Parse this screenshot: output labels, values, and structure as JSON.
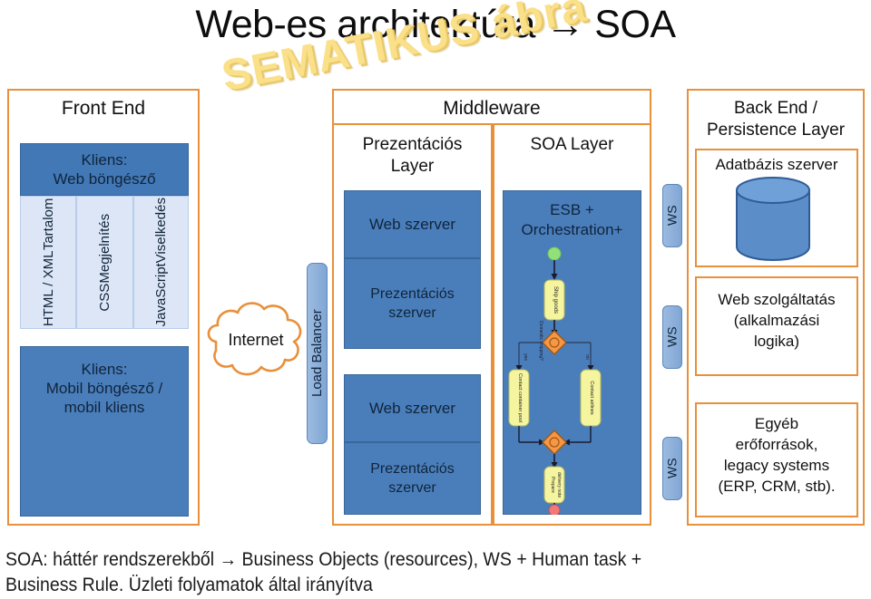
{
  "slide": {
    "title": "Web-es architektúra → SOA",
    "wordart": "SEMATIKUS ábra",
    "footer_line1": "SOA: háttér rendszerekből → Business Objects (resources), WS + Human task +",
    "footer_line2": "Business Rule. Üzleti folyamatok által irányítva"
  },
  "colors": {
    "zone_border": "#E8903A",
    "box_fill": "#4A7EBB",
    "box_fill_dark": "#4178B5",
    "light_fill": "#DCE6F6",
    "wordart": "#FBE08A",
    "flow_task": "#F2F29A",
    "flow_start": "#92E07A",
    "flow_end": "#F07878",
    "flow_gateway": "#F79646"
  },
  "front_end": {
    "title": "Front End",
    "client_web": "Kliens:\nWeb böngésző",
    "columns": [
      {
        "line1": "Tartalom",
        "line2": "HTML / XML"
      },
      {
        "line1": "Megjelnítés",
        "line2": "CSS"
      },
      {
        "line1": "Viselkedés",
        "line2": "JavaScript"
      }
    ],
    "client_mobile": "Kliens:\nMobil böngésző /\nmobil kliens"
  },
  "network": {
    "internet": "Internet",
    "load_balancer": "Load Balancer"
  },
  "middleware": {
    "title": "Middleware",
    "presentation": {
      "title": "Prezentációs\nLayer",
      "boxes": [
        "Web szerver",
        "Prezentációs\nszerver",
        "Web szerver",
        "Prezentációs\nszerver"
      ]
    },
    "soa": {
      "title": "SOA Layer",
      "box_title": "ESB +\nOrchestration+"
    }
  },
  "flowchart": {
    "start": "start",
    "end": "end",
    "nodes": [
      {
        "id": "ship",
        "label": "Ship goods",
        "type": "task"
      },
      {
        "id": "gw1",
        "label": "",
        "type": "gateway"
      },
      {
        "id": "pool",
        "label": "Contact container pool",
        "type": "task"
      },
      {
        "id": "air",
        "label": "Contact airlines",
        "type": "task"
      },
      {
        "id": "gw2",
        "label": "",
        "type": "gateway"
      },
      {
        "id": "note",
        "label": "Prepare delivery note",
        "type": "task"
      }
    ],
    "edge_labels": {
      "decision": "Domestic shipping?",
      "branch_left": "yes",
      "branch_right": "no"
    }
  },
  "back_end": {
    "title": "Back End /\nPersistence Layer",
    "db_title": "Adatbázis szerver",
    "service": "Web szolgáltatás\n(alkalmazási\nlogika)",
    "legacy": "Egyéb\nerőforrások,\nlegacy systems\n(ERP, CRM, stb)."
  },
  "ws_connectors": [
    {
      "label": "WS"
    },
    {
      "label": "WS"
    },
    {
      "label": "WS"
    }
  ]
}
